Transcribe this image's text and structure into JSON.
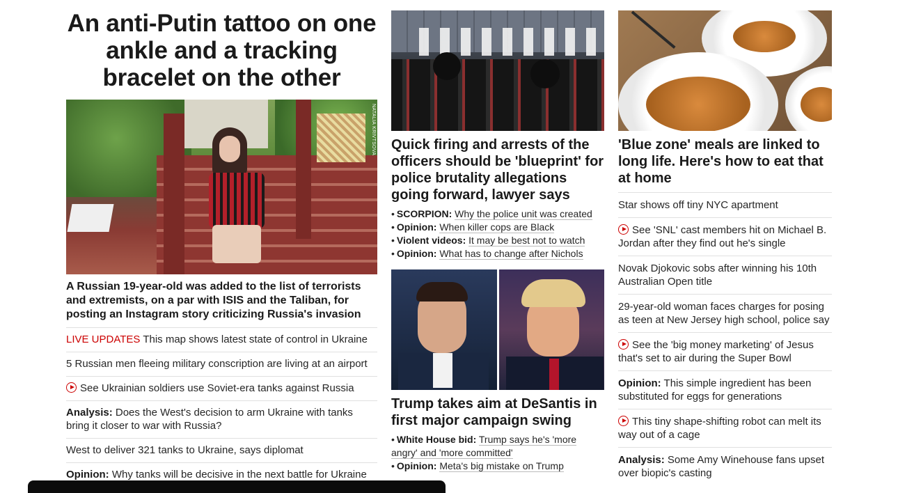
{
  "left": {
    "headline": "An anti-Putin tattoo on one ankle and a tracking bracelet on the other",
    "photo_credit": "NATALIA KRIVTSOVA",
    "caption": "A Russian 19-year-old was added to the list of terrorists and extremists, on a par with ISIS and the Taliban, for posting an Instagram story criticizing Russia's invasion",
    "stories": [
      {
        "prefix": "LIVE UPDATES",
        "text": " This map shows latest state of control in Ukraine"
      },
      {
        "text": "5 Russian men fleeing military conscription are living at an airport"
      },
      {
        "video": true,
        "text": "See Ukrainian soldiers use Soviet-era tanks against Russia"
      },
      {
        "label": "Analysis:",
        "text": " Does the West's decision to arm Ukraine with tanks bring it closer to war with Russia?"
      },
      {
        "text": "West to deliver 321 tanks to Ukraine, says diplomat"
      },
      {
        "label": "Opinion:",
        "text": " Why tanks will be decisive in the next battle for Ukraine"
      }
    ]
  },
  "middle": {
    "top_headline": "Quick firing and arrests of the officers should be 'blueprint' for police brutality allegations going forward, lawyer says",
    "top_bullets": [
      {
        "label": "SCORPION:",
        "text": "Why the police unit was created"
      },
      {
        "label": "Opinion:",
        "text": "When killer cops are Black"
      },
      {
        "label": "Violent videos:",
        "text": "It may be best not to watch"
      },
      {
        "label": "Opinion:",
        "text": "What has to change after Nichols"
      }
    ],
    "second_headline": "Trump takes aim at DeSantis in first major campaign swing",
    "second_bullets": [
      {
        "label": "White House bid:",
        "text": "Trump says he's 'more angry' and 'more committed'"
      },
      {
        "label": "Opinion:",
        "text": "Meta's big mistake on Trump"
      }
    ]
  },
  "right": {
    "headline": "'Blue zone' meals are linked to long life. Here's how to eat that at home",
    "stories": [
      {
        "text": "Star shows off tiny NYC apartment"
      },
      {
        "video": true,
        "text": "See 'SNL' cast members hit on Michael B. Jordan after they find out he's single"
      },
      {
        "text": "Novak Djokovic sobs after winning his 10th Australian Open title"
      },
      {
        "text": "29-year-old woman faces charges for posing as teen at New Jersey high school, police say"
      },
      {
        "video": true,
        "text": "See the 'big money marketing' of Jesus that's set to air during the Super Bowl"
      },
      {
        "label": "Opinion:",
        "text": " This simple ingredient has been substituted for eggs for generations"
      },
      {
        "video": true,
        "text": "This tiny shape-shifting robot can melt its way out of a cage"
      },
      {
        "label": "Analysis:",
        "text": " Some Amy Winehouse fans upset over biopic's casting"
      }
    ]
  },
  "colors": {
    "accent_red": "#cc0000",
    "text": "#1a1a1a",
    "divider": "#e0e0e0"
  },
  "icons": {
    "video": "play-circle-icon"
  }
}
